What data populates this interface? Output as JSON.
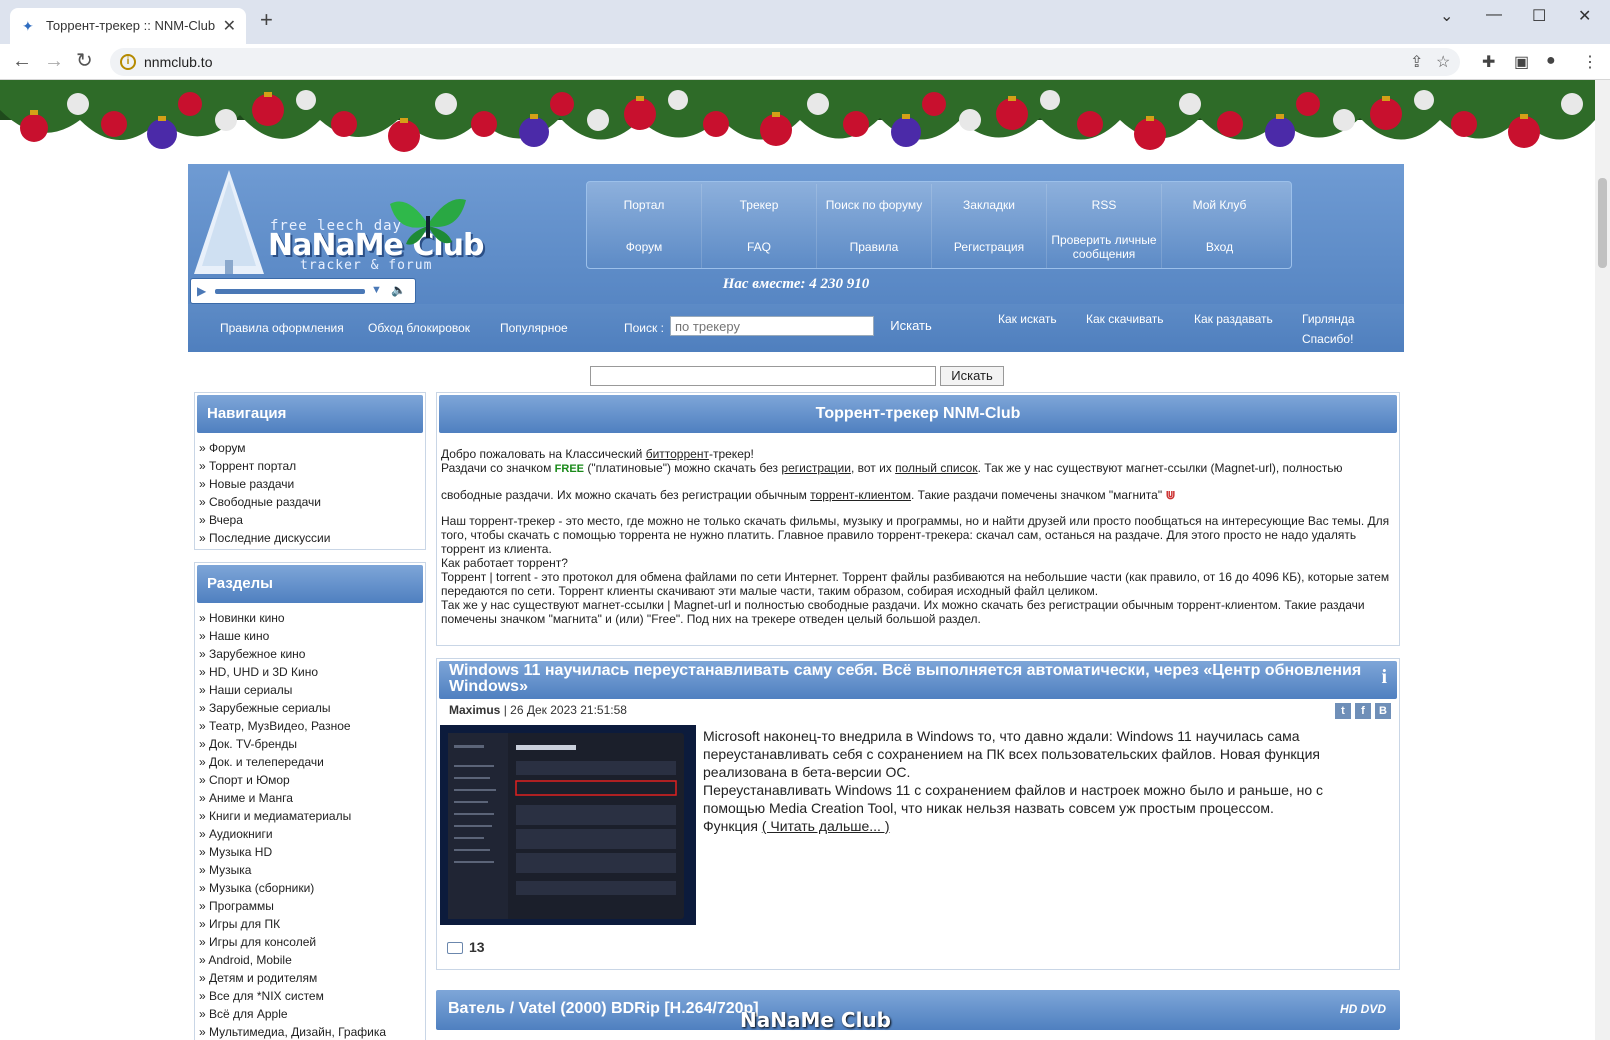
{
  "browser": {
    "tab_title": "Торрент-трекер :: NNM-Club",
    "url": "nnmclub.to"
  },
  "header": {
    "logo_top": "free leech day",
    "logo_main": "NaNaMe Club",
    "logo_sub": "tracker & forum",
    "menu": [
      [
        "Портал",
        "Трекер",
        "Поиск по форуму",
        "Закладки",
        "RSS",
        "Мой Клуб"
      ],
      [
        "Форум",
        "FAQ",
        "Правила",
        "Регистрация",
        "Проверить личные сообщения",
        "Вход"
      ]
    ],
    "together": "Нас вместе: 4 230 910",
    "sublinks": [
      "Правила оформления",
      "Обход блокировок",
      "Популярное"
    ],
    "search_label": "Поиск :",
    "search_placeholder": "по трекеру",
    "search_button": "Искать",
    "help_links": [
      "Как искать",
      "Как скачивать",
      "Как раздавать",
      "Гирлянда",
      "Спасибо!"
    ]
  },
  "search2": {
    "button": "Искать"
  },
  "sidebar": {
    "nav_title": "Навигация",
    "nav_items": [
      "Форум",
      "Торрент портал",
      "Новые раздачи",
      "Свободные раздачи",
      "Вчера",
      "Последние дискуссии"
    ],
    "sections_title": "Разделы",
    "section_items": [
      "Новинки кино",
      "Наше кино",
      "Зарубежное кино",
      "HD, UHD и 3D Кино",
      "Наши сериалы",
      "Зарубежные сериалы",
      "Театр, МузВидео, Разное",
      "Док. TV-бренды",
      "Док. и телепередачи",
      "Спорт и Юмор",
      "Аниме и Манга",
      "Книги и медиаматериалы",
      "Аудиокниги",
      "Музыка HD",
      "Музыка",
      "Музыка (сборники)",
      "Программы",
      "Игры для ПК",
      "Игры для консолей",
      "Android, Mobile",
      "Детям и родителям",
      "Все для *NIX систем",
      "Всё для Apple",
      "Мультимедиа, Дизайн, Графика"
    ]
  },
  "main": {
    "title": "Торрент-трекер NNM-Club",
    "intro": {
      "l1a": "Добро пожаловать на Классический ",
      "l1link": "битторрент",
      "l1b": "-трекер!",
      "l2a": "Раздачи со значком ",
      "free": "FREE",
      "l2b": " (\"платиновые\") можно скачать без ",
      "l2link1": "регистрации",
      "l2c": ", вот их ",
      "l2link2": "полный список",
      "l2d": ". Так же у нас существуют магнет-ссылки (Magnet-url), полностью",
      "l3a": "свободные раздачи. Их можно скачать без регистрации обычным ",
      "l3link": "торрент-клиентом",
      "l3b": ". Такие раздачи помечены значком \"магнита\"",
      "p2": "Наш торрент-трекер - это место, где можно не только скачать фильмы, музыку и программы, но и найти друзей или просто пообщаться на интересующие Вас темы. Для того, чтобы скачать с помощью торрента не нужно платить. Главное правило торрент-трекера: скачал сам, останься на раздаче. Для этого просто не надо удалять торрент из клиента.",
      "p3": "Как работает торрент?",
      "p4": "Торрент | torrent - это протокол для обмена файлами по сети Интернет. Торрент файлы разбиваются на небольшие части (как правило, от 16 до 4096 КБ), которые затем передаются по сети. Торрент клиенты скачивают эти малые части, таким образом, собирая исходный файл целиком.",
      "p5": "Так же у нас существуют магнет-ссылки | Magnet-url и полностью свободные раздачи. Их можно скачать без регистрации обычным торрент-клиентом. Такие раздачи помечены значком \"магнита\" и (или) \"Free\". Под них на трекере отведен целый большой раздел."
    },
    "news": {
      "title": "Windows 11 научилась переустанавливать саму себя. Всё выполняется автоматически, через «Центр обновления Windows»",
      "author": "Maximus",
      "date": "| 26 Дек 2023 21:51:58",
      "share": [
        "t",
        "f",
        "B"
      ],
      "text1": "Microsoft наконец-то внедрила в Windows то, что давно ждали: Windows 11 научилась сама переустанавливать себя с сохранением на ПК всех пользовательских файлов. Новая функция реализована в бета-версии ОС.",
      "text2": "Переустанавливать Windows 11 с сохранением файлов и настроек можно было и раньше, но с помощью Media Creation Tool, что никак нельзя назвать совсем уж простым процессом.",
      "text3": "Функция ",
      "read_more": "( Читать дальше... )",
      "comments": "13"
    },
    "release_title": "Ватель / Vatel (2000) BDRip [H.264/720p]",
    "release_badge": "HD DVD",
    "watermark": "NaNaMe Club"
  },
  "colors": {
    "header_blue": "#4f7fbe",
    "free_green": "#1a8a1a"
  }
}
